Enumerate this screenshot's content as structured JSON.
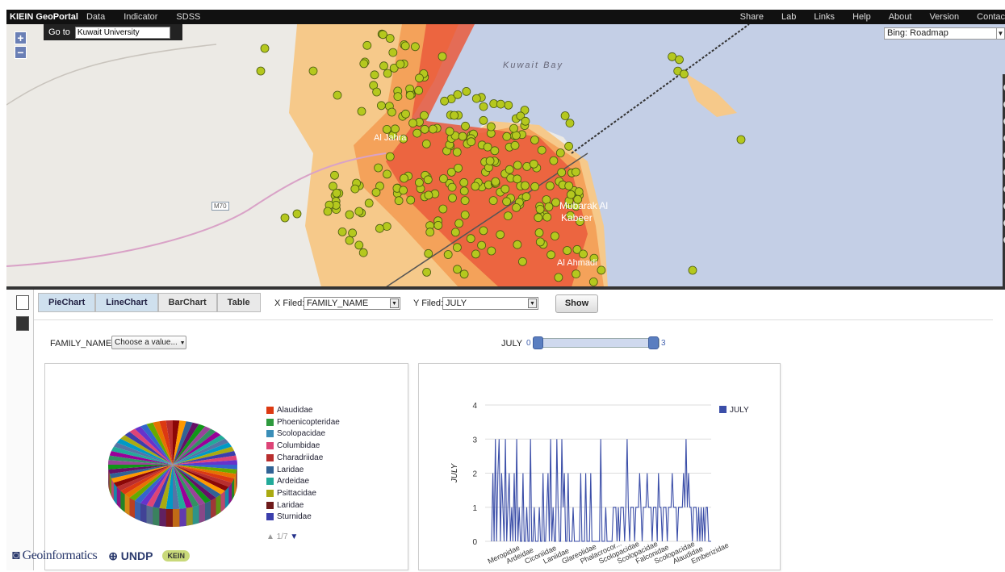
{
  "nav": {
    "brand": "KIEIN GeoPortal",
    "left_items": [
      "Data",
      "Indicator",
      "SDSS"
    ],
    "right_items": [
      "Share",
      "Lab",
      "Links",
      "Help",
      "About",
      "Version",
      "Contac"
    ]
  },
  "map": {
    "goto_label": "Go to",
    "goto_value": "Kuwait University",
    "zoom_in": "+",
    "zoom_out": "−",
    "basemap": "Bing: Roadmap",
    "labels": {
      "bay": "Kuwait Bay",
      "jahra": "Al Jahra",
      "road": "M70",
      "mubarak": "Mubarak Al",
      "kabeer": "Kabeer",
      "ahmadi": "Al Ahmadi"
    },
    "layer_colors": {
      "sea": "#c4cfe6",
      "low": "#f6c98a",
      "mid": "#f4a25a",
      "high": "#ea5a3c",
      "marker": "#b5c81e"
    }
  },
  "toolbar": {
    "tabs": [
      "PieChart",
      "LineChart",
      "BarChart",
      "Table"
    ],
    "active_tabs": [
      "PieChart",
      "LineChart"
    ],
    "x_label": "X Filed:",
    "x_value": "FAMILY_NAME",
    "y_label": "Y Filed:",
    "y_value": "JULY",
    "show_button": "Show"
  },
  "filter": {
    "family_label": "FAMILY_NAME",
    "family_placeholder": "Choose a value...",
    "slider_label": "JULY",
    "slider_min": "0",
    "slider_max": "3",
    "slider_range": [
      0,
      3
    ]
  },
  "pie": {
    "legend": [
      {
        "label": "Alaudidae",
        "color": "#dc3912"
      },
      {
        "label": "Phoenicopteridae",
        "color": "#2e9a3e"
      },
      {
        "label": "Scolopacidae",
        "color": "#3b8eb8"
      },
      {
        "label": "Columbidae",
        "color": "#dd4477"
      },
      {
        "label": "Charadriidae",
        "color": "#b82e2e"
      },
      {
        "label": "Laridae",
        "color": "#316395"
      },
      {
        "label": "Ardeidae",
        "color": "#22aa99"
      },
      {
        "label": "Psittacidae",
        "color": "#aaaa11"
      },
      {
        "label": "Laridae",
        "color": "#6e1a1a"
      },
      {
        "label": "Sturnidae",
        "color": "#3b3eac"
      }
    ],
    "pager": "1/7"
  },
  "chart_data": {
    "type": "line",
    "ylabel": "JULY",
    "xlabel": "",
    "ylim": [
      0,
      4
    ],
    "yticks": [
      0,
      1,
      2,
      3,
      4
    ],
    "legend": [
      "JULY"
    ],
    "color": "#3b4ea8",
    "x_tick_labels": [
      "Meropidae",
      "Ardeidae",
      "Ciconiidae",
      "Laniidae",
      "Glareolidae",
      "Phalacrocor...",
      "Scolopacidae",
      "Scolopacidae",
      "Falconidae",
      "Scolopacidae",
      "Alaudidae",
      "Emberizidae"
    ],
    "series": [
      {
        "name": "JULY",
        "values": [
          0,
          2,
          0,
          3,
          0,
          2,
          3,
          0,
          2,
          1,
          0,
          3,
          0,
          1,
          2,
          0,
          1,
          0,
          2,
          0,
          3,
          0,
          1,
          0,
          0,
          2,
          0,
          0,
          1,
          0,
          0,
          3,
          0,
          0,
          1,
          0,
          0,
          0,
          1,
          0,
          0,
          2,
          0,
          0,
          1,
          2,
          0,
          3,
          0,
          1,
          0,
          0,
          3,
          1,
          0,
          0,
          3,
          1,
          2,
          0,
          0,
          2,
          0,
          0,
          0,
          1,
          0,
          0,
          0,
          0,
          0,
          2,
          0,
          0,
          0,
          2,
          0,
          0,
          0,
          2,
          0,
          0,
          0,
          0,
          0,
          0,
          0,
          3,
          0,
          0,
          0,
          1,
          0,
          0,
          0,
          0,
          0,
          1,
          1,
          1,
          0,
          1,
          0,
          1,
          1,
          1,
          0,
          1,
          3,
          1,
          0,
          1,
          1,
          1,
          0,
          1,
          1,
          1,
          2,
          1,
          0,
          1,
          1,
          1,
          2,
          1,
          1,
          1,
          0,
          1,
          1,
          1,
          0,
          2,
          1,
          1,
          0,
          1,
          1,
          1,
          0,
          1,
          1,
          1,
          2,
          1,
          1,
          1,
          0,
          1,
          1,
          1,
          1,
          2,
          1,
          3,
          1,
          2,
          1,
          1,
          0,
          1,
          1,
          1,
          0,
          1,
          0,
          1,
          0,
          1,
          0,
          1,
          1,
          0,
          0,
          0
        ]
      }
    ]
  }
}
